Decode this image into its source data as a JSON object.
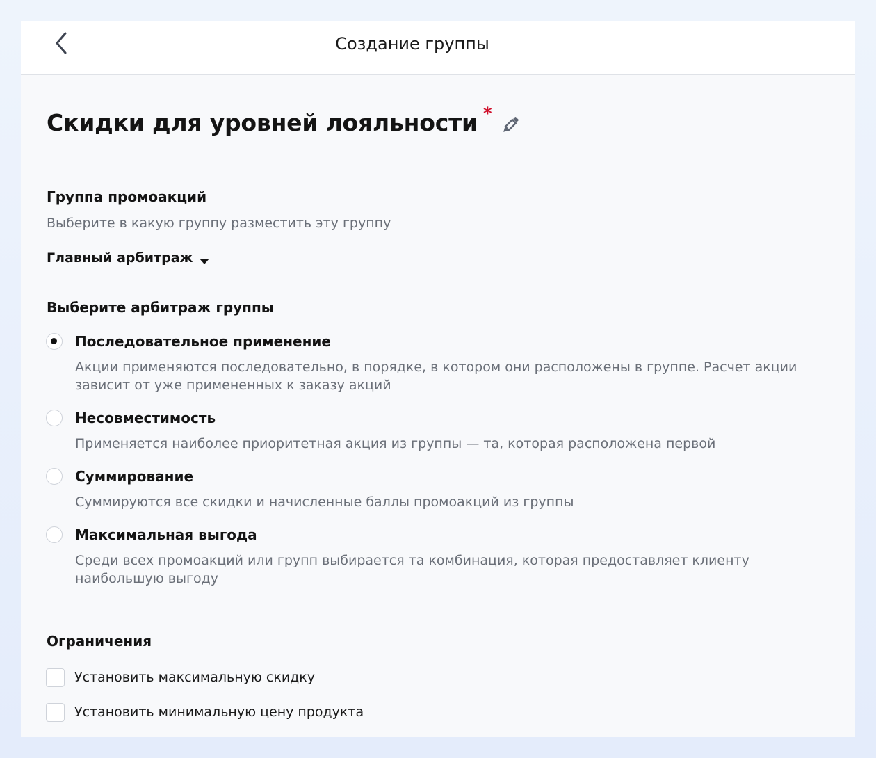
{
  "header": {
    "title": "Создание группы",
    "back_icon": "chevron-left-icon"
  },
  "group": {
    "name": "Скидки для уровней лояльности",
    "required_mark": "*",
    "edit_icon": "pencil-icon"
  },
  "promo_group": {
    "label": "Группа промоакций",
    "hint": "Выберите в какую группу разместить эту группу",
    "selected": "Главный арбитраж",
    "caret_icon": "caret-down-icon"
  },
  "arbitration": {
    "label": "Выберите арбитраж группы",
    "selected_index": 0,
    "options": [
      {
        "label": "Последовательное применение",
        "description": "Акции применяются последовательно, в порядке, в котором они расположены в группе. Расчет акции зависит от уже примененных к заказу акций",
        "selected": true
      },
      {
        "label": "Несовместимость",
        "description": "Применяется наиболее приоритетная акция из группы — та, которая расположена первой",
        "selected": false
      },
      {
        "label": "Суммирование",
        "description": "Суммируются все скидки и начисленные баллы промоакций из группы",
        "selected": false
      },
      {
        "label": "Максимальная выгода",
        "description": "Среди всех промоакций или групп выбирается та комбинация, которая предоставляет клиенту наибольшую выгоду",
        "selected": false
      }
    ]
  },
  "restrictions": {
    "label": "Ограничения",
    "items": [
      {
        "label": "Установить максимальную скидку",
        "checked": false
      },
      {
        "label": "Установить минимальную цену продукта",
        "checked": false
      }
    ]
  },
  "colors": {
    "required": "#d0102b",
    "text_primary": "#141414",
    "text_secondary": "#6a6f78",
    "panel_bg": "#f8f9fb",
    "page_bg": "#e8effb"
  }
}
